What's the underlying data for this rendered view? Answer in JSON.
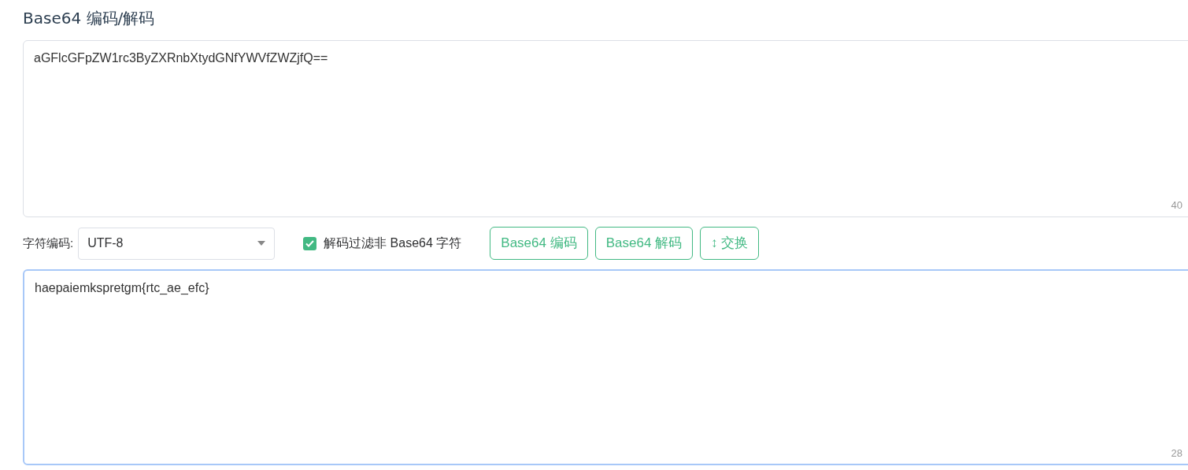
{
  "title": "Base64 编码/解码",
  "input": {
    "value": "aGFlcGFpZW1rc3ByZXRnbXtydGNfYWVfZWZjfQ==",
    "count": "40"
  },
  "encoding": {
    "label": "字符编码:",
    "value": "UTF-8"
  },
  "filter": {
    "label": "解码过滤非 Base64 字符",
    "checked": true
  },
  "buttons": [
    "Base64 编码",
    "Base64 解码",
    "↕ 交换"
  ],
  "output": {
    "value": "haepaiemkspretgm{rtc_ae_efc}",
    "count": "28",
    "focused": true
  }
}
